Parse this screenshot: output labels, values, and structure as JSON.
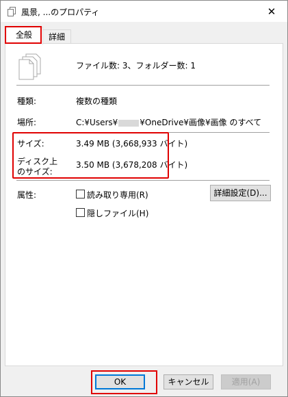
{
  "window": {
    "title": "風景, ...のプロパティ",
    "close_glyph": "✕"
  },
  "tabs": [
    {
      "label": "全般",
      "active": true
    },
    {
      "label": "詳細",
      "active": false
    }
  ],
  "summary": {
    "text": "ファイル数: 3、フォルダー数: 1"
  },
  "properties": {
    "type_label": "種類:",
    "type_value": "複数の種類",
    "location_label": "場所:",
    "location_prefix": "C:¥Users¥",
    "location_suffix": "¥OneDrive¥画像¥画像 のすべて",
    "size_label": "サイズ:",
    "size_value": "3.49 MB (3,668,933 バイト)",
    "disk_size_label_line1": "ディスク上",
    "disk_size_label_line2": "のサイズ:",
    "disk_size_value": "3.50 MB (3,678,208 バイト)"
  },
  "attributes": {
    "label": "属性:",
    "readonly_label": "読み取り専用(R)",
    "readonly_checked": false,
    "hidden_label": "隠しファイル(H)",
    "hidden_checked": false,
    "advanced_button": "詳細設定(D)..."
  },
  "buttons": {
    "ok": "OK",
    "cancel": "キャンセル",
    "apply": "適用(A)",
    "apply_enabled": false
  },
  "colors": {
    "highlight": "#e00000",
    "accent": "#0078d7",
    "panel": "#ffffff",
    "dialog": "#f0f0f0"
  }
}
